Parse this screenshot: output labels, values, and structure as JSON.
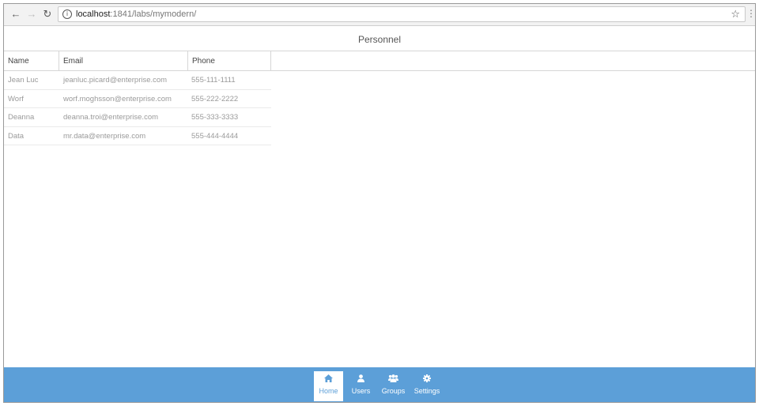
{
  "browser": {
    "url_host": "localhost",
    "url_path": ":1841/labs/mymodern/",
    "back_icon": "arrow-left-icon",
    "forward_icon": "arrow-right-icon",
    "reload_icon": "reload-icon",
    "bookmark_icon": "star-icon",
    "menu_icon": "more-icon"
  },
  "app": {
    "title": "Personnel"
  },
  "grid": {
    "columns": [
      "Name",
      "Email",
      "Phone"
    ],
    "rows": [
      {
        "name": "Jean Luc",
        "email": "jeanluc.picard@enterprise.com",
        "phone": "555-111-1111"
      },
      {
        "name": "Worf",
        "email": "worf.moghsson@enterprise.com",
        "phone": "555-222-2222"
      },
      {
        "name": "Deanna",
        "email": "deanna.troi@enterprise.com",
        "phone": "555-333-3333"
      },
      {
        "name": "Data",
        "email": "mr.data@enterprise.com",
        "phone": "555-444-4444"
      }
    ]
  },
  "tabbar": {
    "color": "#5c9fd8",
    "tabs": [
      {
        "label": "Home",
        "icon": "home-icon",
        "active": true
      },
      {
        "label": "Users",
        "icon": "user-icon",
        "active": false
      },
      {
        "label": "Groups",
        "icon": "group-icon",
        "active": false
      },
      {
        "label": "Settings",
        "icon": "gear-icon",
        "active": false
      }
    ]
  }
}
